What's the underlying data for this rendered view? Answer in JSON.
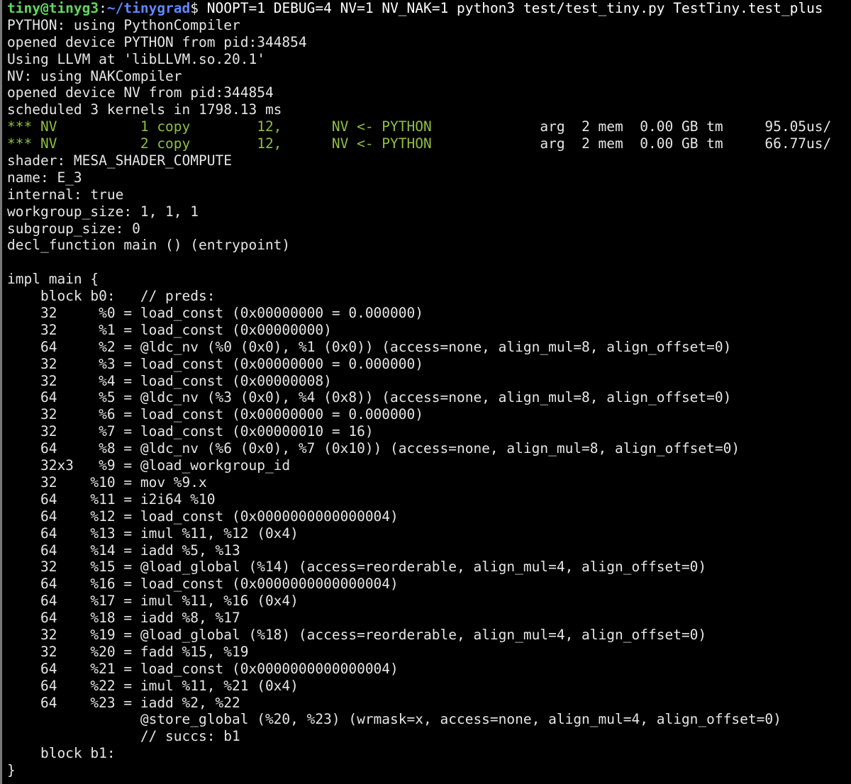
{
  "terminal": {
    "prompt": {
      "user_host": "tiny@tinyg3",
      "sep1": ":",
      "path": "~/tinygrad",
      "symbol": "$",
      "command": " NOOPT=1 DEBUG=4 NV=1 NV_NAK=1 python3 test/test_tiny.py TestTiny.test_plus"
    },
    "output_lines_a": [
      "PYTHON: using PythonCompiler",
      "opened device PYTHON from pid:344854",
      "Using LLVM at 'libLLVM.so.20.1'",
      "NV: using NAKCompiler",
      "opened device NV from pid:344854",
      "scheduled 3 kernels in 1798.13 ms"
    ],
    "green_lines": [
      {
        "left": "*** NV          1 copy        12,      NV <- PYTHON",
        "right": "             arg  2 mem  0.00 GB tm     95.05us/"
      },
      {
        "left": "*** NV          2 copy        12,      NV <- PYTHON",
        "right": "             arg  2 mem  0.00 GB tm     66.77us/"
      }
    ],
    "output_lines_b": [
      "shader: MESA_SHADER_COMPUTE",
      "name: E_3",
      "internal: true",
      "workgroup_size: 1, 1, 1",
      "subgroup_size: 0",
      "decl_function main () (entrypoint)",
      "",
      "impl main {",
      "    block b0:   // preds:",
      "    32     %0 = load_const (0x00000000 = 0.000000)",
      "    32     %1 = load_const (0x00000000)",
      "    64     %2 = @ldc_nv (%0 (0x0), %1 (0x0)) (access=none, align_mul=8, align_offset=0)",
      "    32     %3 = load_const (0x00000000 = 0.000000)",
      "    32     %4 = load_const (0x00000008)",
      "    64     %5 = @ldc_nv (%3 (0x0), %4 (0x8)) (access=none, align_mul=8, align_offset=0)",
      "    32     %6 = load_const (0x00000000 = 0.000000)",
      "    32     %7 = load_const (0x00000010 = 16)",
      "    64     %8 = @ldc_nv (%6 (0x0), %7 (0x10)) (access=none, align_mul=8, align_offset=0)",
      "    32x3   %9 = @load_workgroup_id",
      "    32    %10 = mov %9.x",
      "    64    %11 = i2i64 %10",
      "    64    %12 = load_const (0x0000000000000004)",
      "    64    %13 = imul %11, %12 (0x4)",
      "    64    %14 = iadd %5, %13",
      "    32    %15 = @load_global (%14) (access=reorderable, align_mul=4, align_offset=0)",
      "    64    %16 = load_const (0x0000000000000004)",
      "    64    %17 = imul %11, %16 (0x4)",
      "    64    %18 = iadd %8, %17",
      "    32    %19 = @load_global (%18) (access=reorderable, align_mul=4, align_offset=0)",
      "    32    %20 = fadd %15, %19",
      "    64    %21 = load_const (0x0000000000000004)",
      "    64    %22 = imul %11, %21 (0x4)",
      "    64    %23 = iadd %2, %22",
      "                @store_global (%20, %23) (wrmask=x, access=none, align_mul=4, align_offset=0)",
      "                // succs: b1",
      "    block b1:",
      "}"
    ]
  },
  "colors": {
    "background": "#000000",
    "text": "#e6e6e6",
    "prompt_user": "#5fd75f",
    "prompt_path": "#5f87ff",
    "green_output": "#8fbf3f"
  }
}
